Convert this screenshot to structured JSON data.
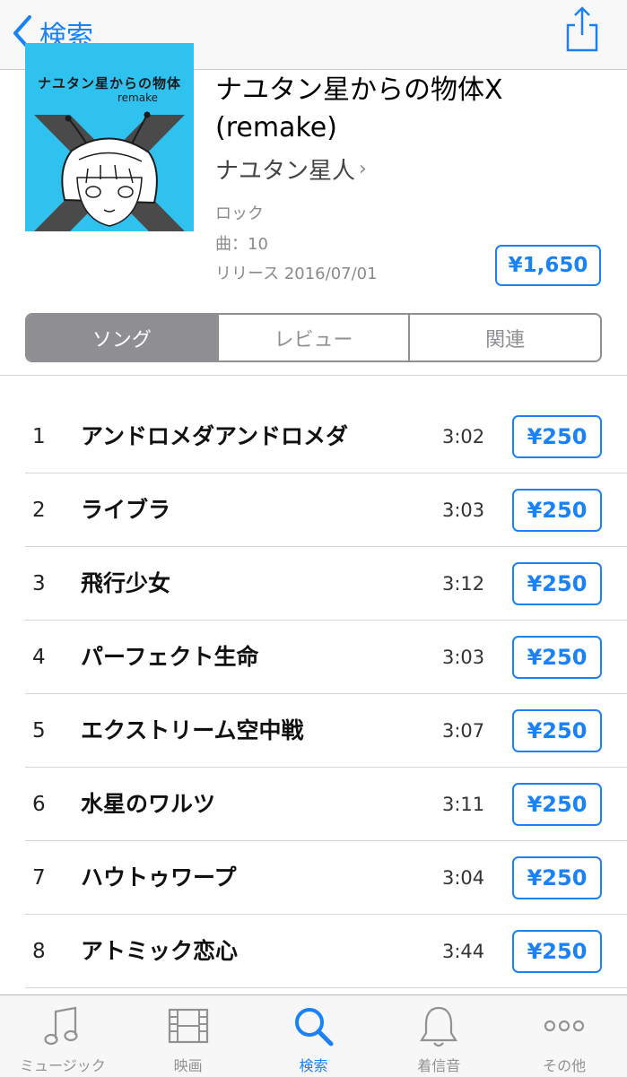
{
  "nav": {
    "back_label": "検索"
  },
  "album": {
    "artwork_title": "ナユタン星からの物体",
    "artwork_subtitle": "remake",
    "title": "ナユタン星からの物体X (remake)",
    "artist": "ナユタン星人",
    "genre": "ロック",
    "track_count": "曲：10",
    "release": "リリース 2016/07/01",
    "price": "¥1,650"
  },
  "segments": [
    {
      "label": "ソング",
      "active": true
    },
    {
      "label": "レビュー",
      "active": false
    },
    {
      "label": "関連",
      "active": false
    }
  ],
  "tracks": [
    {
      "num": "1",
      "title": "アンドロメダアンドロメダ",
      "duration": "3:02",
      "price": "¥250"
    },
    {
      "num": "2",
      "title": "ライブラ",
      "duration": "3:03",
      "price": "¥250"
    },
    {
      "num": "3",
      "title": "飛行少女",
      "duration": "3:12",
      "price": "¥250"
    },
    {
      "num": "4",
      "title": "パーフェクト生命",
      "duration": "3:03",
      "price": "¥250"
    },
    {
      "num": "5",
      "title": "エクストリーム空中戦",
      "duration": "3:07",
      "price": "¥250"
    },
    {
      "num": "6",
      "title": "水星のワルツ",
      "duration": "3:11",
      "price": "¥250"
    },
    {
      "num": "7",
      "title": "ハウトゥワープ",
      "duration": "3:04",
      "price": "¥250"
    },
    {
      "num": "8",
      "title": "アトミック恋心",
      "duration": "3:44",
      "price": "¥250"
    }
  ],
  "tabbar": [
    {
      "label": "ミュージック",
      "icon": "music-note-icon",
      "active": false
    },
    {
      "label": "映画",
      "icon": "film-icon",
      "active": false
    },
    {
      "label": "検索",
      "icon": "search-icon",
      "active": true
    },
    {
      "label": "着信音",
      "icon": "bell-icon",
      "active": false
    },
    {
      "label": "その他",
      "icon": "more-icon",
      "active": false
    }
  ],
  "colors": {
    "accent": "#1a82f7",
    "artwork_bg": "#2fc2ef",
    "segment_active": "#8e8e93"
  }
}
